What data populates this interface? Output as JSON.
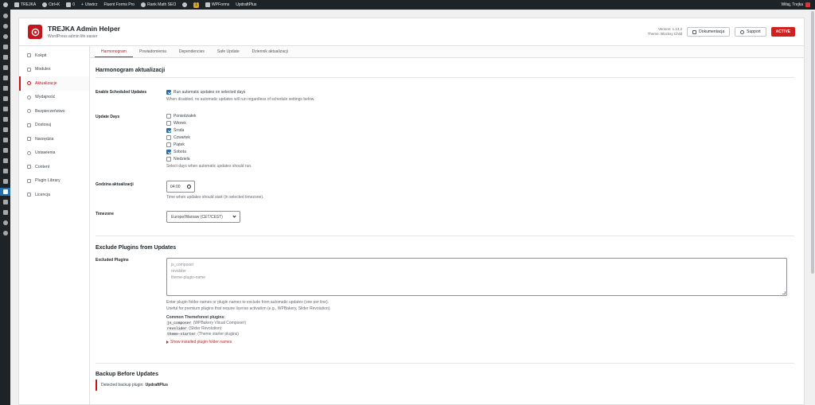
{
  "adminbar": {
    "site_name": "TREJKA",
    "shortcut": "Ctrl+K",
    "comments_count": "0",
    "new_label": "Utwórz",
    "plugins": [
      "Fluent Forms Pro",
      "Rank Math SEO"
    ],
    "badge": "1",
    "extra": [
      "WPForms",
      "UpdraftPlus"
    ],
    "greeting": "Witaj, Trejka"
  },
  "header": {
    "title": "TREJKA Admin Helper",
    "subtitle": "WordPress admin life easier",
    "version_line": "Version: 1.13.2",
    "theme_line": "Theme: Blocksy Child",
    "docs_button": "Dokumentacja",
    "support_button": "Support",
    "status_badge": "ACTIVE",
    "brand_color": "#c4161c"
  },
  "nav": {
    "items": [
      {
        "label": "Kokpit",
        "icon": "dashboard-icon"
      },
      {
        "label": "Modules",
        "icon": "grid-icon"
      },
      {
        "label": "Aktualizacje",
        "icon": "update-icon"
      },
      {
        "label": "Wydajność",
        "icon": "performance-icon"
      },
      {
        "label": "Bezpieczeństwo",
        "icon": "shield-icon"
      },
      {
        "label": "Dostosuj",
        "icon": "brush-icon"
      },
      {
        "label": "Narzędzia",
        "icon": "tools-icon"
      },
      {
        "label": "Ustawienia",
        "icon": "settings-icon"
      },
      {
        "label": "Content",
        "icon": "content-icon"
      },
      {
        "label": "Plugin Library",
        "icon": "library-icon"
      },
      {
        "label": "Licencja",
        "icon": "key-icon"
      }
    ],
    "active_index": 2
  },
  "tabs": [
    "Harmonogram",
    "Powiadomienia",
    "Dependencies",
    "Safe Update",
    "Dziennik aktualizacji"
  ],
  "schedule": {
    "title": "Harmonogram aktualizacji",
    "enable_label": "Enable Scheduled Updates",
    "enable_checkbox": "Run automatic updates on selected days",
    "enable_checked": true,
    "enable_desc": "When disabled, no automatic updates will run regardless of schedule settings below.",
    "days_label": "Update Days",
    "days": [
      {
        "name": "Poniedziałek",
        "checked": false
      },
      {
        "name": "Wtorek",
        "checked": false
      },
      {
        "name": "Środa",
        "checked": true
      },
      {
        "name": "Czwartek",
        "checked": false
      },
      {
        "name": "Piątek",
        "checked": false
      },
      {
        "name": "Sobota",
        "checked": true
      },
      {
        "name": "Niedziela",
        "checked": false
      }
    ],
    "days_desc": "Select days when automatic updates should run.",
    "time_label": "Godzina aktualizacji",
    "time_value": "04:00",
    "time_desc": "Time when updates should start (in selected timezone).",
    "tz_label": "Timezone",
    "tz_value": "Europe/Warsaw (CET/CEST)"
  },
  "exclude": {
    "title": "Exclude Plugins from Updates",
    "label": "Excluded Plugins",
    "placeholder_lines": [
      "js_composer",
      "revslider",
      "theme-plugin-name"
    ],
    "desc1": "Enter plugin folder names or plugin names to exclude from automatic updates (one per line).",
    "desc2": "Useful for premium plugins that require license activation (e.g., WPBakery, Slider Revolution).",
    "common_title": "Common Themeforest plugins:",
    "common": [
      {
        "code": "js_composer",
        "desc": "(WPBakery Visual Composer)"
      },
      {
        "code": "revslider",
        "desc": "(Slider Revolution)"
      },
      {
        "code": "theme-starter",
        "desc": "(Theme starter plugins)"
      }
    ],
    "show_link": "Show installed plugin folder names"
  },
  "backup": {
    "title": "Backup Before Updates",
    "notice_prefix": "Detected backup plugin:",
    "notice_plugin": "UpdraftPlus"
  }
}
